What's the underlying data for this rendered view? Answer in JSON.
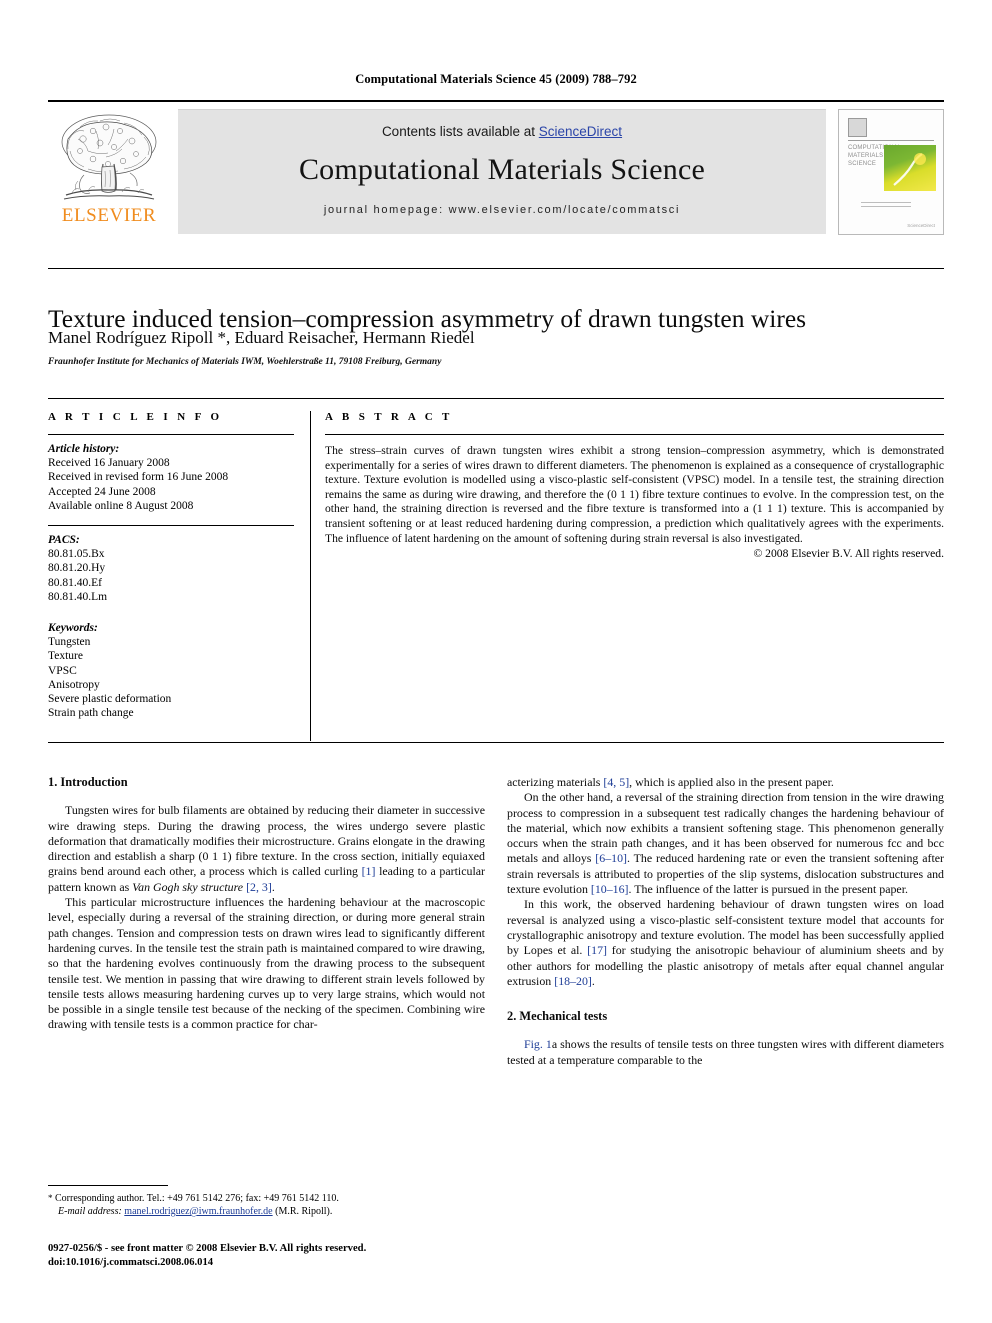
{
  "running_head": "Computational Materials Science 45 (2009) 788–792",
  "masthead": {
    "contents_prefix": "Contents lists available at ",
    "sciencedirect": "ScienceDirect",
    "journal_title": "Computational Materials Science",
    "homepage": "journal homepage: www.elsevier.com/locate/commatsci",
    "publisher_wordmark": "ELSEVIER",
    "publisher_color": "#F08C1E",
    "link_color": "#2b45a8",
    "cover": {
      "line1": "COMPUTATIONAL",
      "line2": "MATERIALS",
      "line3": "SCIENCE",
      "footer_left": "",
      "footer_right": "ScienceDirect"
    }
  },
  "article": {
    "title": "Texture induced tension–compression asymmetry of drawn tungsten wires",
    "authors": "Manel Rodríguez Ripoll *, Eduard Reisacher, Hermann Riedel",
    "affiliation": "Fraunhofer Institute for Mechanics of Materials IWM, Woehlerstraße 11, 79108 Freiburg, Germany"
  },
  "info": {
    "heading": "A R T I C L E    I N F O",
    "history_label": "Article history:",
    "history": [
      "Received 16 January 2008",
      "Received in revised form 16 June 2008",
      "Accepted 24 June 2008",
      "Available online 8 August 2008"
    ],
    "pacs_label": "PACS:",
    "pacs": [
      "80.81.05.Bx",
      "80.81.20.Hy",
      "80.81.40.Ef",
      "80.81.40.Lm"
    ],
    "keywords_label": "Keywords:",
    "keywords": [
      "Tungsten",
      "Texture",
      "VPSC",
      "Anisotropy",
      "Severe plastic deformation",
      "Strain path change"
    ]
  },
  "abstract": {
    "heading": "A B S T R A C T",
    "text": "The stress–strain curves of drawn tungsten wires exhibit a strong tension–compression asymmetry, which is demonstrated experimentally for a series of wires drawn to different diameters. The phenomenon is explained as a consequence of crystallographic texture. Texture evolution is modelled using a visco-plastic self-consistent (VPSC) model. In a tensile test, the straining direction remains the same as during wire drawing, and therefore the (0 1 1) fibre texture continues to evolve. In the compression test, on the other hand, the straining direction is reversed and the fibre texture is transformed into a (1 1 1) texture. This is accompanied by transient softening or at least reduced hardening during compression, a prediction which qualitatively agrees with the experiments. The influence of latent hardening on the amount of softening during strain reversal is also investigated.",
    "copyright": "© 2008 Elsevier B.V. All rights reserved."
  },
  "body": {
    "section1_heading": "1. Introduction",
    "section2_heading": "2. Mechanical tests",
    "left_paragraphs": [
      {
        "parts": [
          {
            "t": "Tungsten wires for bulb filaments are obtained by reducing their diameter in successive wire drawing steps. During the drawing process, the wires undergo severe plastic deformation that dramatically modifies their microstructure. Grains elongate in the drawing direction and establish a sharp (0 1 1) fibre texture. In the cross section, initially equiaxed grains bend around each other, a process which is called curling "
          },
          {
            "t": "[1]",
            "style": "ref"
          },
          {
            "t": " leading to a particular pattern known as "
          },
          {
            "t": "Van Gogh sky structure",
            "style": "ital"
          },
          {
            "t": " "
          },
          {
            "t": "[2, 3]",
            "style": "ref"
          },
          {
            "t": "."
          }
        ]
      },
      {
        "parts": [
          {
            "t": "This particular microstructure influences the hardening behaviour at the macroscopic level, especially during a reversal of the straining direction, or during more general strain path changes. Tension and compression tests on drawn wires lead to significantly different hardening curves. In the tensile test the strain path is maintained compared to wire drawing, so that the hardening evolves continuously from the drawing process to the subsequent tensile test. We mention in passing that wire drawing to different strain levels followed by tensile tests allows measuring hardening curves up to very large strains, which would not be possible in a single tensile test because of the necking of the specimen. Combining wire drawing with tensile tests is a common practice for char-"
          }
        ]
      }
    ],
    "right_paragraphs": [
      {
        "indent": false,
        "parts": [
          {
            "t": "acterizing materials "
          },
          {
            "t": "[4, 5]",
            "style": "ref"
          },
          {
            "t": ", which is applied also in the present paper."
          }
        ]
      },
      {
        "indent": true,
        "parts": [
          {
            "t": "On the other hand, a reversal of the straining direction from tension in the wire drawing process to compression in a subsequent test radically changes the hardening behaviour of the material, which now exhibits a transient softening stage. This phenomenon generally occurs when the strain path changes, and it has been observed for numerous fcc and bcc metals and alloys "
          },
          {
            "t": "[6–10]",
            "style": "ref"
          },
          {
            "t": ". The reduced hardening rate or even the transient softening after strain reversals is attributed to properties of the slip systems, dislocation substructures and texture evolution "
          },
          {
            "t": "[10–16]",
            "style": "ref"
          },
          {
            "t": ". The influence of the latter is pursued in the present paper."
          }
        ]
      },
      {
        "indent": true,
        "parts": [
          {
            "t": "In this work, the observed hardening behaviour of drawn tungsten wires on load reversal is analyzed using a visco-plastic self-consistent texture model that accounts for crystallographic anisotropy and texture evolution. The model has been successfully applied by Lopes et al. "
          },
          {
            "t": "[17]",
            "style": "ref"
          },
          {
            "t": " for studying the anisotropic behaviour of aluminium sheets and by other authors for modelling the plastic anisotropy of metals after equal channel angular extrusion "
          },
          {
            "t": "[18–20]",
            "style": "ref"
          },
          {
            "t": "."
          }
        ]
      }
    ],
    "section2_paragraphs": [
      {
        "indent": true,
        "parts": [
          {
            "t": "Fig. 1",
            "style": "ref"
          },
          {
            "t": "a shows the results of tensile tests on three tungsten wires with different diameters tested at a temperature comparable to the"
          }
        ]
      }
    ]
  },
  "footnote": {
    "marker": "*",
    "corresponding": " Corresponding author. Tel.: +49 761 5142 276; fax: +49 761 5142 110.",
    "email_label": "E-mail address:",
    "email": "manel.rodriguez@iwm.fraunhofer.de",
    "email_suffix": " (M.R. Ripoll)."
  },
  "footer": {
    "line1": "0927-0256/$ - see front matter © 2008 Elsevier B.V. All rights reserved.",
    "line2": "doi:10.1016/j.commatsci.2008.06.014"
  }
}
